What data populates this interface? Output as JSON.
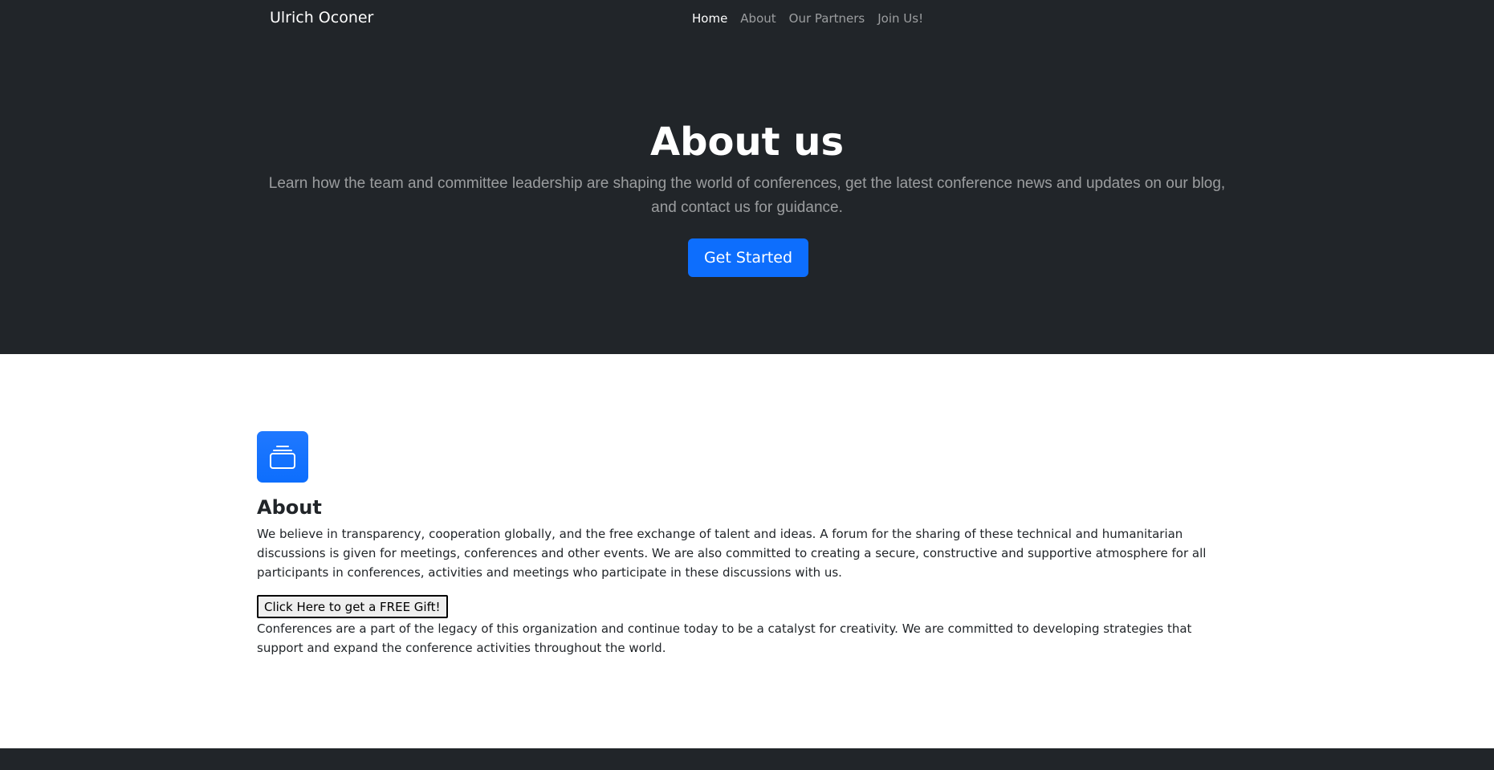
{
  "navbar": {
    "brand": "Ulrich Oconer",
    "items": [
      {
        "label": "Home",
        "active": true
      },
      {
        "label": "About",
        "active": false
      },
      {
        "label": "Our Partners",
        "active": false
      },
      {
        "label": "Join Us!",
        "active": false
      }
    ]
  },
  "hero": {
    "title": "About us",
    "lead": "Learn how the team and committee leadership are shaping the world of conferences, get the latest conference news and updates on our blog, and contact us for guidance.",
    "cta_label": "Get Started"
  },
  "about": {
    "icon": "collection-icon",
    "title": "About",
    "paragraph": "We believe in transparency, cooperation globally, and the free exchange of talent and ideas. A forum for the sharing of these technical and humanitarian discussions is given for meetings, conferences and other events. We are also committed to creating a secure, constructive and supportive atmosphere for all participants in conferences, activities and meetings who participate in these discussions with us.",
    "gift_button_label": "Click Here to get a FREE Gift!",
    "legacy_paragraph": "Conferences are a part of the legacy of this organization and continue today to be a catalyst for creativity. We are committed to developing strategies that support and expand the conference activities throughout the world."
  },
  "colors": {
    "dark_bg": "#212529",
    "primary": "#0d6efd",
    "text": "#212529"
  }
}
